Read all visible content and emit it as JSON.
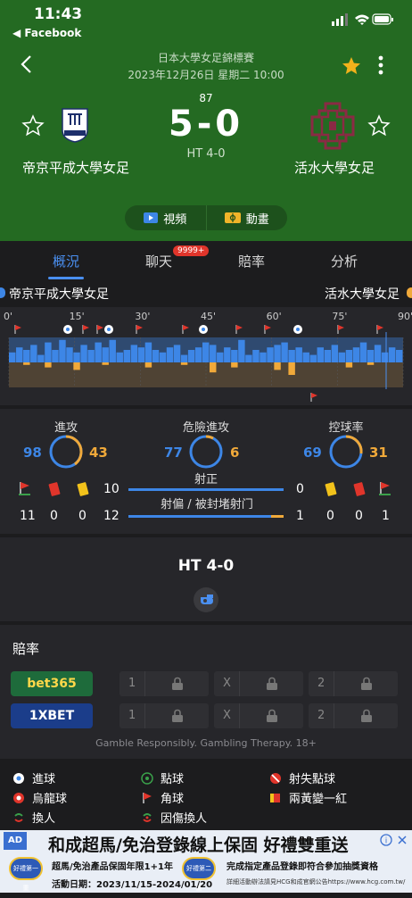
{
  "status_bar": {
    "time": "11:43",
    "back_app": "◀ Facebook"
  },
  "match": {
    "league": "日本大學女足錦標賽",
    "datetime": "2023年12月26日 星期二 10:00",
    "minute": "87",
    "score": "5-0",
    "halftime": "HT 4-0",
    "home_team": "帝京平成大學女足",
    "away_team": "活水大學女足"
  },
  "media": {
    "video_label": "視頻",
    "animation_label": "動畫"
  },
  "tabs": [
    {
      "label": "概況"
    },
    {
      "label": "聊天"
    },
    {
      "label": "賠率"
    },
    {
      "label": "分析"
    }
  ],
  "chat_badge": "9999+",
  "teams_bar": {
    "home": "帝京平成大學女足",
    "away": "活水大學女足"
  },
  "timeline": {
    "ticks": [
      "0'",
      "15'",
      "30'",
      "45'",
      "60'",
      "75'",
      "90'"
    ],
    "home_pressure": [
      4,
      6,
      5,
      7,
      3,
      8,
      5,
      9,
      6,
      4,
      7,
      5,
      8,
      6,
      9,
      4,
      5,
      7,
      6,
      8,
      5,
      4,
      6,
      7,
      3,
      5,
      6,
      8,
      7,
      4,
      6,
      5,
      9,
      3,
      5,
      4,
      6,
      7,
      8,
      5,
      6,
      4,
      3,
      6,
      5,
      7,
      4,
      5,
      6,
      8,
      5,
      7,
      4,
      6,
      5
    ],
    "away_pressure": [
      0,
      0,
      1,
      0,
      0,
      2,
      0,
      0,
      0,
      3,
      0,
      0,
      0,
      1,
      0,
      0,
      0,
      0,
      0,
      2,
      0,
      0,
      0,
      0,
      1,
      0,
      0,
      0,
      4,
      0,
      0,
      2,
      0,
      0,
      0,
      0,
      0,
      3,
      0,
      5,
      0,
      0,
      0,
      0,
      0,
      0,
      0,
      2,
      0,
      0,
      1,
      0,
      0,
      0,
      0
    ]
  },
  "stats": {
    "attack": {
      "label": "進攻",
      "home": 98,
      "away": 43
    },
    "dangerous": {
      "label": "危險進攻",
      "home": 77,
      "away": 6
    },
    "possession": {
      "label": "控球率",
      "home": 69,
      "away": 31
    },
    "shots_on": {
      "label": "射正",
      "home": 10,
      "away": 0
    },
    "shots_off": {
      "label": "射偏 / 被封堵射门",
      "home": 12,
      "away": 1
    },
    "home_cards": {
      "corners": 11,
      "red": 0,
      "yellow": 0
    },
    "away_cards": {
      "yellow": 0,
      "red": 0,
      "corners": 1
    }
  },
  "halftime_panel": {
    "label": "HT 4-0"
  },
  "odds": {
    "title": "賠率",
    "books": [
      {
        "name": "bet365",
        "color": "#1e6b3b",
        "text_color": "#ffd84a"
      },
      {
        "name": "1XBET",
        "color": "#1b3d8a",
        "text_color": "#ffffff"
      }
    ],
    "cells": [
      "1",
      "X",
      "2"
    ],
    "disclaimer": "Gamble Responsibly. Gambling Therapy. 18+"
  },
  "legend": {
    "goal": "進球",
    "penalty": "點球",
    "missed_penalty": "射失點球",
    "own_goal": "烏龍球",
    "corner": "角球",
    "second_yellow": "兩黃變一紅",
    "sub": "換人",
    "injury_sub": "因傷換人"
  },
  "ad": {
    "tag": "AD",
    "title": "和成超馬/免治登錄線上保固 好禮雙重送",
    "line1a": "超馬/免治產品保固年限1+1年",
    "line1b": "完成指定產品登錄即符合參加抽獎資格",
    "line2a": "活動日期：2023/11/15-2024/01/20",
    "line2b": "詳細活動辦法請見HCG和成官網公告https://www.hcg.com.tw/",
    "badge1": "好禮第一重",
    "badge2": "好禮第二重"
  },
  "colors": {
    "header_green": "#246a22",
    "home_blue": "#3d86e6",
    "away_orange": "#f0a93a",
    "accent": "#4a8ff0"
  }
}
